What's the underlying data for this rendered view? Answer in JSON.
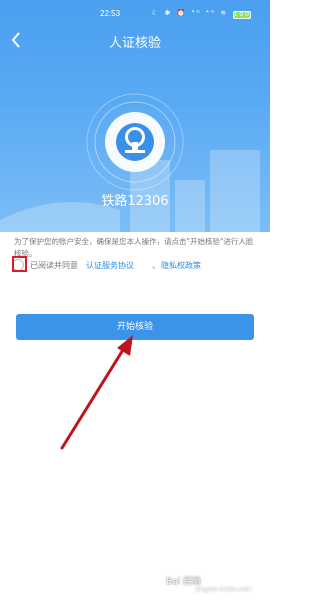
{
  "statusbar": {
    "time": "22:53",
    "icons": "☾ ✱ ⏰ ⁴ᴳ ⁴ᴳ ≋",
    "battery": "100"
  },
  "navbar": {
    "title": "人证核验",
    "back_icon": "chevron-left-icon"
  },
  "app": {
    "logo_icon": "china-railway-logo-icon",
    "name": "铁路12306"
  },
  "notice": {
    "text": "为了保护您的账户安全，确保是您本人操作，请点击\"开始核验\"进行人脸核验。"
  },
  "agreement": {
    "prefix": "已阅读并同意",
    "link_service": "认证服务协议",
    "separator": "、",
    "link_privacy": "隐私权政策",
    "checked": false
  },
  "start_button": {
    "label": "开始核验"
  },
  "annotation": {
    "highlight_color": "#d81e2a",
    "arrow_color": "#c0141c"
  },
  "watermark": {
    "text": "Bai 经验",
    "url": "jingyan.baidu.com"
  },
  "colors": {
    "header_blue": "#4a9ff0",
    "button_blue": "#3a94ea",
    "link_blue": "#2a8ee8"
  }
}
